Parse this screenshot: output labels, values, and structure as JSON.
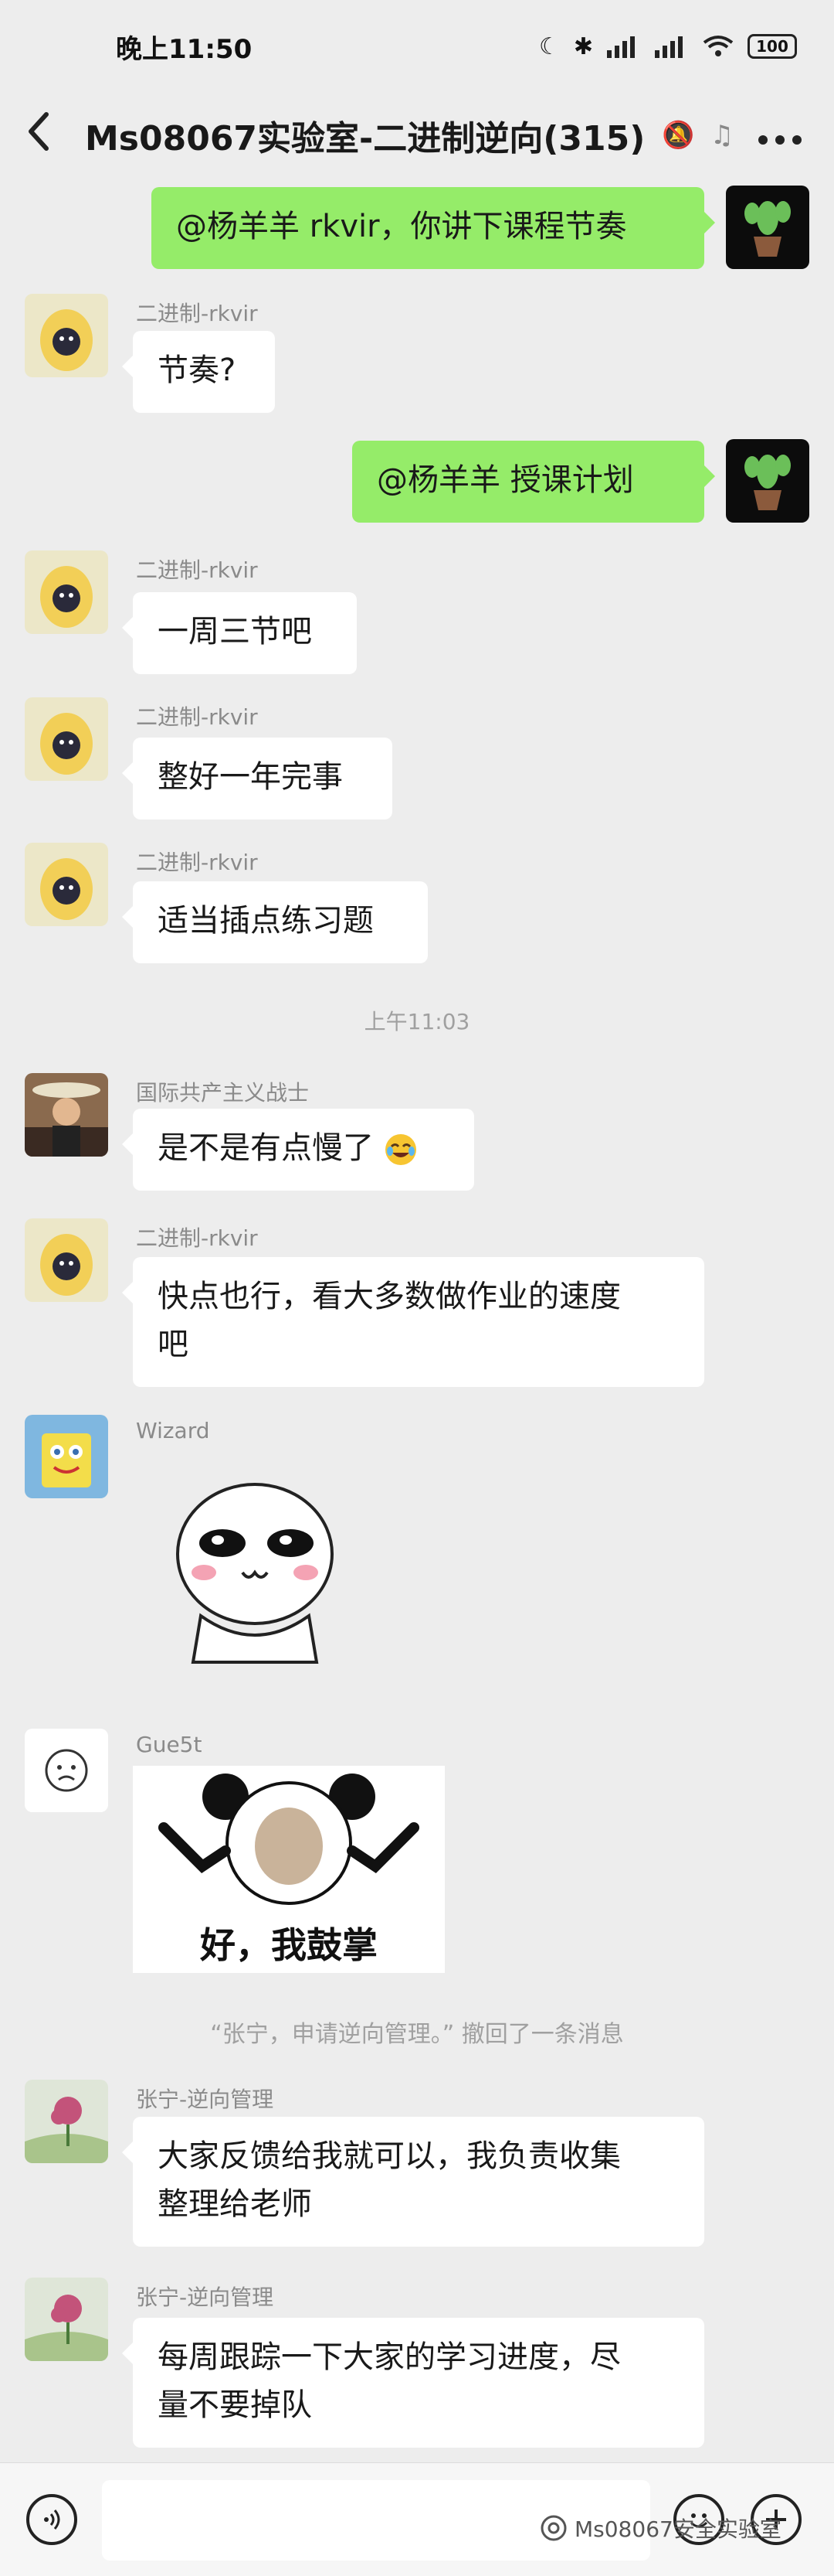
{
  "status_bar": {
    "time": "晚上11:50",
    "battery": "100"
  },
  "header": {
    "back_icon": "chevron-left-icon",
    "title": "Ms08067实验室-二进制逆向(315)",
    "more_icon": "more-icon"
  },
  "messages": [
    {
      "side": "right",
      "text": "@杨羊羊  rkvir，你讲下课程节奏"
    },
    {
      "side": "left",
      "sender": "二进制-rkvir",
      "text": "节奏?"
    },
    {
      "side": "right",
      "text": "@杨羊羊  授课计划"
    },
    {
      "side": "left",
      "sender": "二进制-rkvir",
      "text": "一周三节吧"
    },
    {
      "side": "left",
      "sender": "二进制-rkvir",
      "text": "整好一年完事"
    },
    {
      "side": "left",
      "sender": "二进制-rkvir",
      "text": "适当插点练习题"
    },
    {
      "side": "left",
      "sender": "国际共产主义战士",
      "text": "是不是有点慢了"
    },
    {
      "side": "left",
      "sender": "二进制-rkvir",
      "text_line1": "快点也行，看大多数做作业的速度",
      "text_line2": "吧"
    },
    {
      "side": "left",
      "sender": "Wizard",
      "sticker": "smiling-face-sticker"
    },
    {
      "side": "left",
      "sender": "Gue5t",
      "sticker_caption": "好，我鼓掌"
    },
    {
      "side": "left",
      "sender": "张宁-逆向管理",
      "text_line1": "大家反馈给我就可以，我负责收集",
      "text_line2": "整理给老师"
    },
    {
      "side": "left",
      "sender": "张宁-逆向管理",
      "text_line1": "每周跟踪一下大家的学习进度，尽",
      "text_line2": "量不要掉队"
    }
  ],
  "time_divider": "上午11:03",
  "recall_notice": "“张宁，申请逆向管理。” 撤回了一条消息",
  "input_bar": {
    "voice_icon": "voice-icon",
    "emoji_icon": "emoji-icon",
    "plus_icon": "plus-icon"
  },
  "watermark": "Ms08067安全实验室",
  "colors": {
    "background": "#ededed",
    "self_bubble": "#95ec69",
    "other_bubble": "#ffffff"
  }
}
